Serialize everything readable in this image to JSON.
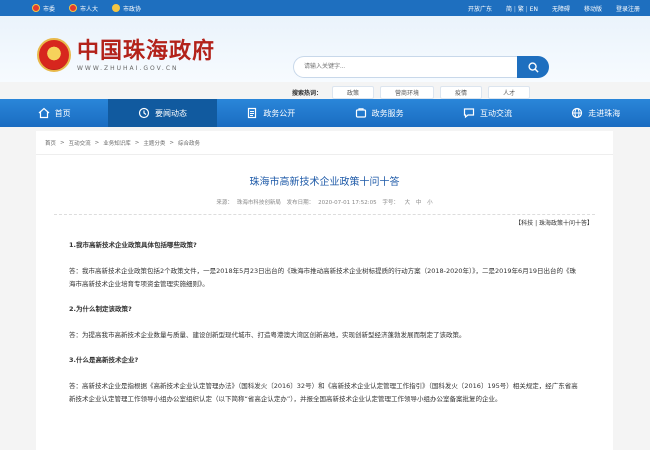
{
  "topbar": {
    "left": [
      "市委",
      "市人大",
      "市政协"
    ],
    "right": [
      "开放广东",
      "简",
      "繁",
      "EN",
      "无障碍",
      "移动版",
      "登录注册"
    ]
  },
  "header": {
    "site_title": "中国珠海政府",
    "site_url": "WWW.ZHUHAI.GOV.CN",
    "search_placeholder": "请输入关键字...",
    "hot_label": "搜索热词：",
    "hot_words": [
      "政策",
      "营商环境",
      "疫情",
      "人才"
    ]
  },
  "nav": [
    {
      "label": "首页",
      "icon": "home-icon"
    },
    {
      "label": "要闻动态",
      "icon": "news-icon"
    },
    {
      "label": "政务公开",
      "icon": "doc-icon"
    },
    {
      "label": "政务服务",
      "icon": "service-icon"
    },
    {
      "label": "互动交流",
      "icon": "chat-icon"
    },
    {
      "label": "走进珠海",
      "icon": "globe-icon"
    }
  ],
  "breadcrumb": [
    "首页",
    "互动交流",
    "业务知识库",
    "主题分类",
    "综合政务"
  ],
  "article": {
    "title": "珠海市高新技术企业政策十问十答",
    "source_label": "来源：",
    "source": "珠海市科技创新局",
    "date_label": "发布日期：",
    "date": "2020-07-01 17:52:05",
    "font_label": "字号：",
    "font_sizes": [
      "大",
      "中",
      "小"
    ],
    "tagline": "【科技 | 珠海政策十问十答】",
    "qa": [
      {
        "q": "1.我市高新技术企业政策具体包括哪些政策?",
        "a": "答：我市高新技术企业政策包括2个政策文件，一是2018年5月23日出台的《珠海市推动高新技术企业树标提质的行动方案（2018-2020年）》，二是2019年6月19日出台的《珠海市高新技术企业培育专项资金管理实施细则》。"
      },
      {
        "q": "2.为什么制定该政策?",
        "a": "答：为提高我市高新技术企业数量与质量、建设创新型现代城市、打造粤港澳大湾区创新高地，实现创新型经济蓬勃发展而制定了该政策。"
      },
      {
        "q": "3.什么是高新技术企业?",
        "a": "答：高新技术企业是指根据《高新技术企业认定管理办法》（国科发火〔2016〕32号）和《高新技术企业认定管理工作指引》（国科发火〔2016〕195号）相关规定，经广东省高新技术企业认定管理工作领导小组办公室组织认定（以下简称“省高企认定办”），并报全国高新技术企业认定管理工作领导小组办公室备案批复的企业。"
      }
    ]
  },
  "colors": {
    "primary": "#1e6fbf",
    "title_red": "#b3221a",
    "link_blue": "#1e5aa8"
  }
}
